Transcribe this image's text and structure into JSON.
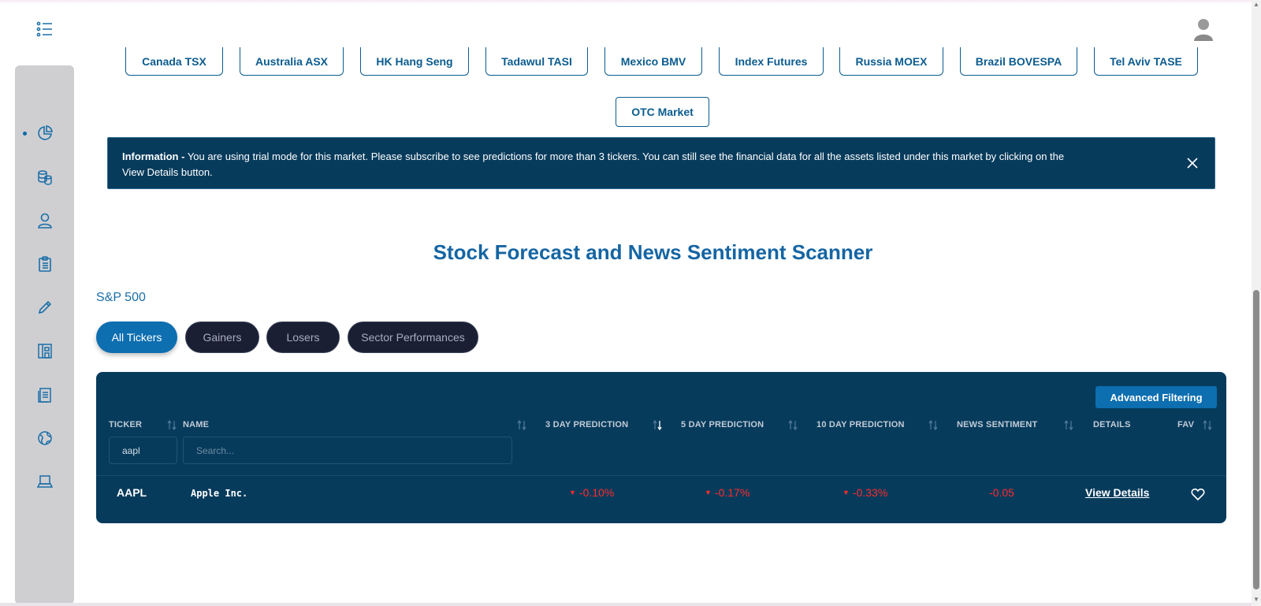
{
  "markets_row1": [
    "Canada TSX",
    "Australia ASX",
    "HK Hang Seng",
    "Tadawul TASI",
    "Mexico BMV",
    "Index Futures",
    "Russia MOEX",
    "Brazil BOVESPA",
    "Tel Aviv TASE"
  ],
  "markets_row2": [
    "OTC Market"
  ],
  "info": {
    "label": "Information -",
    "text": " You are using trial mode for this market. Please subscribe to see predictions for more than 3 tickers. You can still see the financial data for all the assets listed under this market by clicking on the View Details button."
  },
  "page_title": "Stock Forecast and News Sentiment Scanner",
  "market_name": "S&P 500",
  "tabs": [
    "All Tickers",
    "Gainers",
    "Losers",
    "Sector Performances"
  ],
  "advanced_filtering": "Advanced Filtering",
  "columns": {
    "ticker": "TICKER",
    "name": "NAME",
    "pred3": "3 DAY PREDICTION",
    "pred5": "5 DAY PREDICTION",
    "pred10": "10 DAY PREDICTION",
    "sentiment": "NEWS SENTIMENT",
    "details": "DETAILS",
    "fav": "FAV"
  },
  "filters": {
    "ticker_value": "aapl",
    "name_placeholder": "Search..."
  },
  "rows": [
    {
      "ticker": "AAPL",
      "name": "Apple Inc.",
      "pred3": "-0.10%",
      "pred5": "-0.17%",
      "pred10": "-0.33%",
      "sentiment": "-0.05",
      "details": "View Details"
    }
  ],
  "icons": {
    "menu": "list-icon",
    "avatar": "user-avatar-icon",
    "sidebar": [
      "pie-chart-icon",
      "coins-icon",
      "user-icon",
      "clipboard-icon",
      "pencil-icon",
      "building-icon",
      "document-icon",
      "globe-icon",
      "laptop-icon"
    ],
    "close": "close-icon",
    "favorite": "heart-icon"
  },
  "colors": {
    "primary": "#0d6eb0",
    "panel": "#073b5c",
    "negative": "#ff2b2b",
    "title": "#1565a3"
  }
}
